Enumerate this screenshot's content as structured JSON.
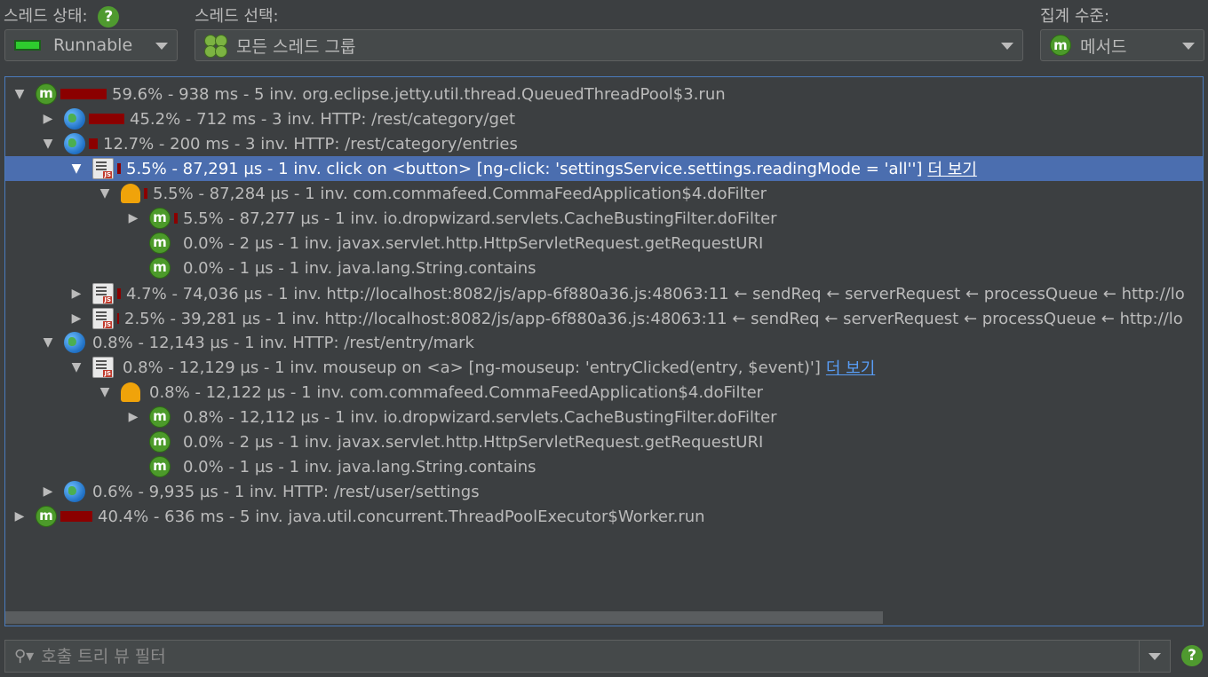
{
  "toolbar": {
    "thread_state_label": "스레드 상태:",
    "thread_state_value": "Runnable",
    "thread_select_label": "스레드 선택:",
    "thread_select_value": "모든 스레드 그룹",
    "agg_label": "집계 수준:",
    "agg_value": "메서드",
    "help_glyph": "?",
    "method_icon_letter": "m"
  },
  "tree": {
    "rows": [
      {
        "text": "59.6% - 938 ms - 5 inv. org.eclipse.jetty.util.thread.QueuedThreadPool$3.run",
        "more": ""
      },
      {
        "text": "45.2% - 712 ms - 3 inv. HTTP: /rest/category/get",
        "more": ""
      },
      {
        "text": "12.7% - 200 ms - 3 inv. HTTP: /rest/category/entries",
        "more": ""
      },
      {
        "text": "5.5% - 87,291 µs - 1 inv. click on <button> [ng-click: 'settingsService.settings.readingMode = 'all'']",
        "more": "더 보기"
      },
      {
        "text": "5.5% - 87,284 µs - 1 inv. com.commafeed.CommaFeedApplication$4.doFilter",
        "more": ""
      },
      {
        "text": "5.5% - 87,277 µs - 1 inv. io.dropwizard.servlets.CacheBustingFilter.doFilter",
        "more": ""
      },
      {
        "text": "0.0% - 2 µs - 1 inv. javax.servlet.http.HttpServletRequest.getRequestURI",
        "more": ""
      },
      {
        "text": "0.0% - 1 µs - 1 inv. java.lang.String.contains",
        "more": ""
      },
      {
        "text": "4.7% - 74,036 µs - 1 inv. http://localhost:8082/js/app-6f880a36.js:48063:11 ← sendReq ← serverRequest ← processQueue ← http://lo",
        "more": ""
      },
      {
        "text": "2.5% - 39,281 µs - 1 inv. http://localhost:8082/js/app-6f880a36.js:48063:11 ← sendReq ← serverRequest ← processQueue ← http://lo",
        "more": ""
      },
      {
        "text": "0.8% - 12,143 µs - 1 inv. HTTP: /rest/entry/mark",
        "more": ""
      },
      {
        "text": "0.8% - 12,129 µs - 1 inv. mouseup on <a> [ng-mouseup: 'entryClicked(entry, $event)']",
        "more": "더 보기"
      },
      {
        "text": "0.8% - 12,122 µs - 1 inv. com.commafeed.CommaFeedApplication$4.doFilter",
        "more": ""
      },
      {
        "text": "0.8% - 12,112 µs - 1 inv. io.dropwizard.servlets.CacheBustingFilter.doFilter",
        "more": ""
      },
      {
        "text": "0.0% - 2 µs - 1 inv. javax.servlet.http.HttpServletRequest.getRequestURI",
        "more": ""
      },
      {
        "text": "0.0% - 1 µs - 1 inv. java.lang.String.contains",
        "more": ""
      },
      {
        "text": "0.6% - 9,935 µs - 1 inv. HTTP: /rest/user/settings",
        "more": ""
      },
      {
        "text": "40.4% - 636 ms - 5 inv. java.util.concurrent.ThreadPoolExecutor$Worker.run",
        "more": ""
      }
    ]
  },
  "filter": {
    "placeholder": "호출 트리 뷰 필터"
  },
  "colors": {
    "background": "#3c3f41",
    "selection": "#4b6eaf",
    "hotbar": "#8b0000",
    "link": "#589df6"
  }
}
